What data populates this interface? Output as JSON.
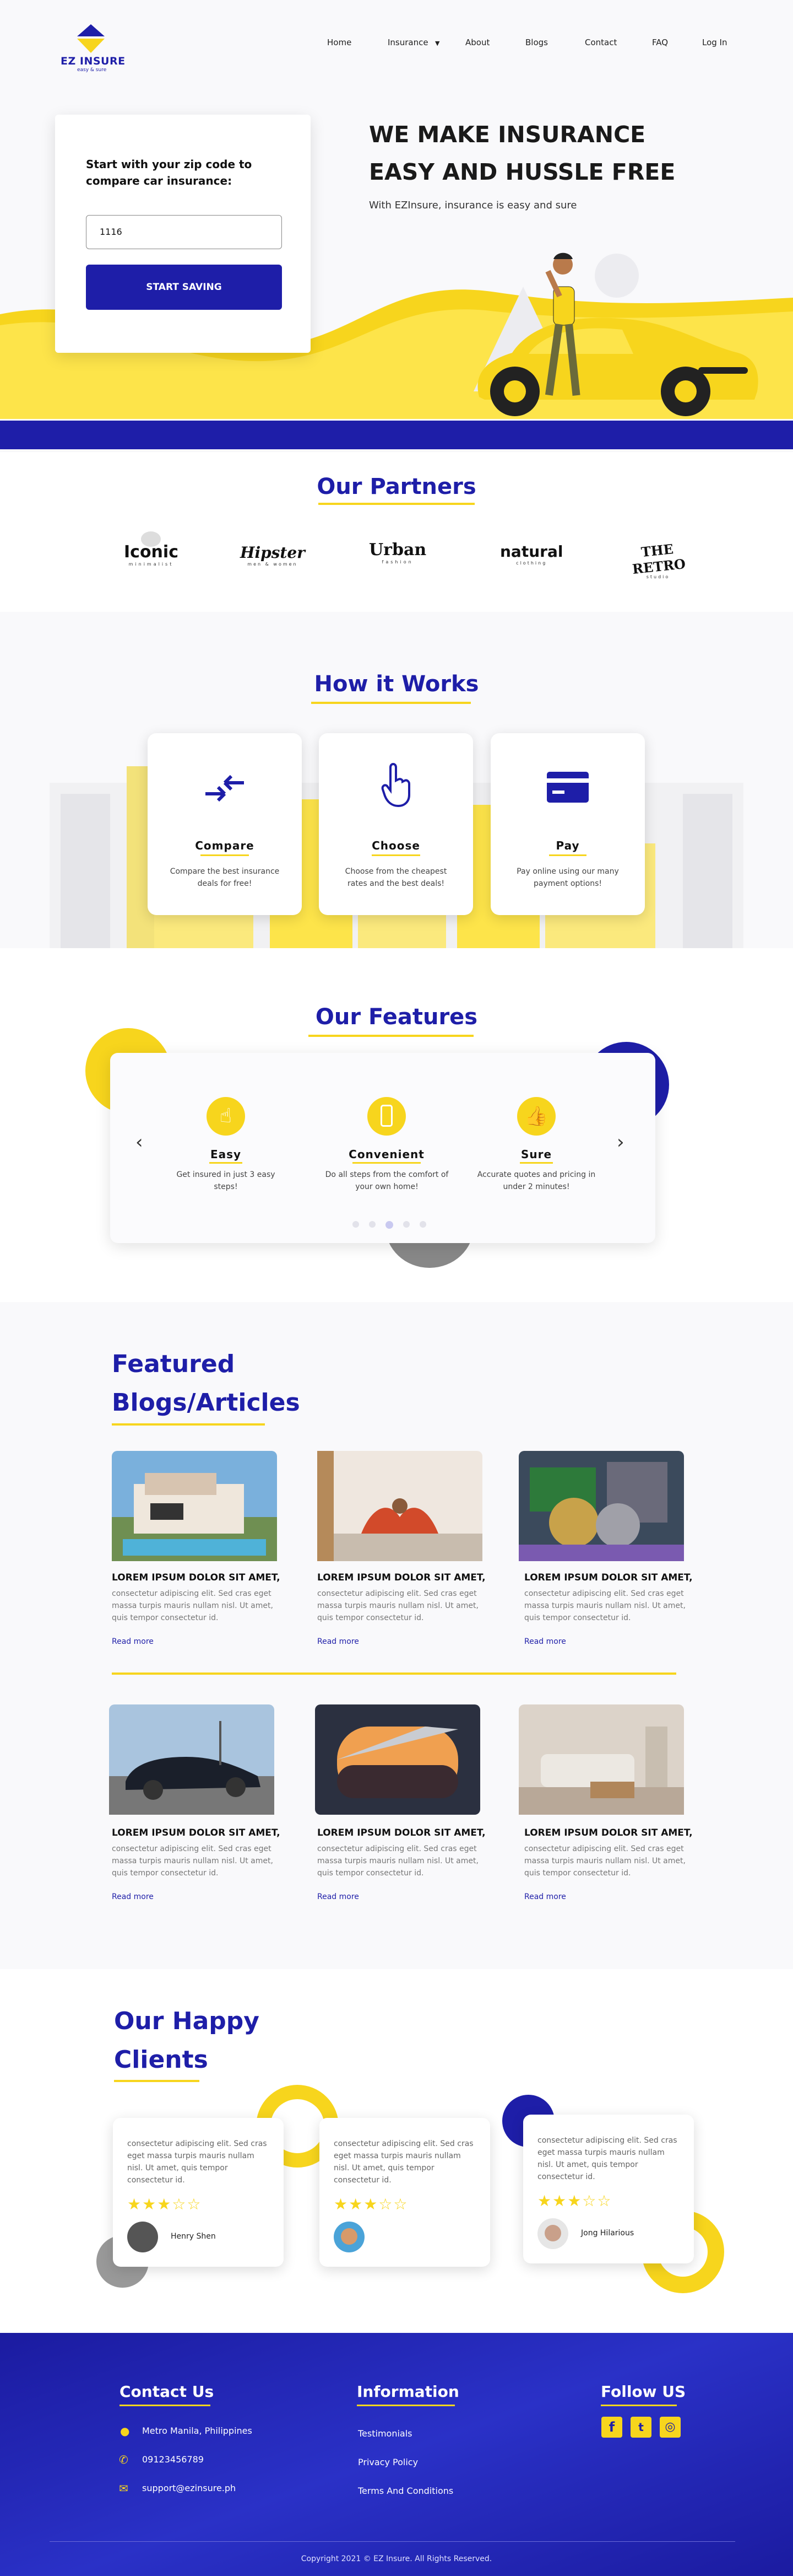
{
  "header": {
    "logo_text": "EZ INSURE",
    "logo_tagline": "easy & sure",
    "nav": [
      "Home",
      "Insurance",
      "About",
      "Blogs",
      "Contact",
      "FAQ",
      "Log In"
    ]
  },
  "hero": {
    "zip_title": "Start with your zip code to compare car insurance:",
    "zip_value": "1116",
    "cta_label": "START SAVING",
    "title_line1": "WE MAKE INSURANCE",
    "title_line2": "EASY AND HUSSLE FREE",
    "subtitle": "With EZInsure, insurance is easy and sure"
  },
  "partners": {
    "title": "Our Partners",
    "logos": [
      {
        "name": "Iconic",
        "sub": "minimalist"
      },
      {
        "name": "Hipster",
        "sub": "men & women"
      },
      {
        "name": "Urban",
        "sub": "fashion"
      },
      {
        "name": "natural",
        "sub": "clothing"
      },
      {
        "name": "THE RETRO",
        "sub": "studio"
      }
    ]
  },
  "how": {
    "title": "How it Works",
    "cards": [
      {
        "title": "Compare",
        "desc": "Compare the best insurance deals for free!",
        "icon": "compare-arrows-icon"
      },
      {
        "title": "Choose",
        "desc": "Choose from the cheapest rates and the best deals!",
        "icon": "hand-pointer-icon"
      },
      {
        "title": "Pay",
        "desc": "Pay online using our many payment options!",
        "icon": "credit-card-icon"
      }
    ]
  },
  "features": {
    "title": "Our Features",
    "items": [
      {
        "title": "Easy",
        "desc": "Get insured in just 3 easy steps!",
        "icon": "pointer-hand-icon"
      },
      {
        "title": "Convenient",
        "desc": "Do all steps from the comfort of your own home!",
        "icon": "mobile-phone-icon"
      },
      {
        "title": "Sure",
        "desc": "Accurate quotes and pricing in under 2 minutes!",
        "icon": "thumbs-up-icon"
      }
    ],
    "dots": 5,
    "active_dot": 3
  },
  "blogs": {
    "title_line1": "Featured",
    "title_line2": "Blogs/Articles",
    "posts": [
      {
        "title": "LOREM IPSUM DOLOR SIT AMET,",
        "desc": "consectetur adipiscing elit. Sed cras eget massa turpis mauris nullam nisl. Ut amet, quis tempor consectetur id.",
        "more": "Read more",
        "img": "house"
      },
      {
        "title": "LOREM IPSUM DOLOR SIT AMET,",
        "desc": "consectetur adipiscing elit. Sed cras eget massa turpis mauris nullam nisl. Ut amet, quis tempor consectetur id.",
        "more": "Read more",
        "img": "yoga"
      },
      {
        "title": "LOREM IPSUM DOLOR SIT AMET,",
        "desc": "consectetur adipiscing elit. Sed cras eget massa turpis mauris nullam nisl. Ut amet, quis tempor consectetur id.",
        "more": "Read more",
        "img": "coins"
      },
      {
        "title": "LOREM IPSUM DOLOR SIT AMET,",
        "desc": "consectetur adipiscing elit. Sed cras eget massa turpis mauris nullam nisl. Ut amet, quis tempor consectetur id.",
        "more": "Read more",
        "img": "car"
      },
      {
        "title": "LOREM IPSUM DOLOR SIT AMET,",
        "desc": "consectetur adipiscing elit. Sed cras eget massa turpis mauris nullam nisl. Ut amet, quis tempor consectetur id.",
        "more": "Read more",
        "img": "sunset"
      },
      {
        "title": "LOREM IPSUM DOLOR SIT AMET,",
        "desc": "consectetur adipiscing elit. Sed cras eget massa turpis mauris nullam nisl. Ut amet, quis tempor consectetur id.",
        "more": "Read more",
        "img": "livingroom"
      }
    ]
  },
  "clients": {
    "title_line1": "Our Happy",
    "title_line2": "Clients",
    "items": [
      {
        "text": "consectetur adipiscing elit. Sed cras eget massa turpis mauris nullam nisl. Ut amet, quis tempor consectetur id.",
        "stars": 3,
        "name": "Henry Shen"
      },
      {
        "text": "consectetur adipiscing elit. Sed cras eget massa turpis mauris nullam nisl. Ut amet, quis tempor consectetur id.",
        "stars": 3,
        "name": ""
      },
      {
        "text": "consectetur adipiscing elit. Sed cras eget massa turpis mauris nullam nisl. Ut amet, quis tempor consectetur id.",
        "stars": 3,
        "name": "Jong Hilarious"
      }
    ]
  },
  "footer": {
    "contact_title": "Contact Us",
    "address": "Metro Manila, Philippines",
    "phone": "09123456789",
    "email": "support@ezinsure.ph",
    "info_title": "Information",
    "links": [
      "Testimonials",
      "Privacy Policy",
      "Terms And Conditions"
    ],
    "follow_title": "Follow US",
    "copyright": "Copyright 2021 © EZ Insure. All Rights Reserved."
  },
  "colors": {
    "brand_blue": "#1e1ea8",
    "brand_yellow": "#f7d51d"
  }
}
